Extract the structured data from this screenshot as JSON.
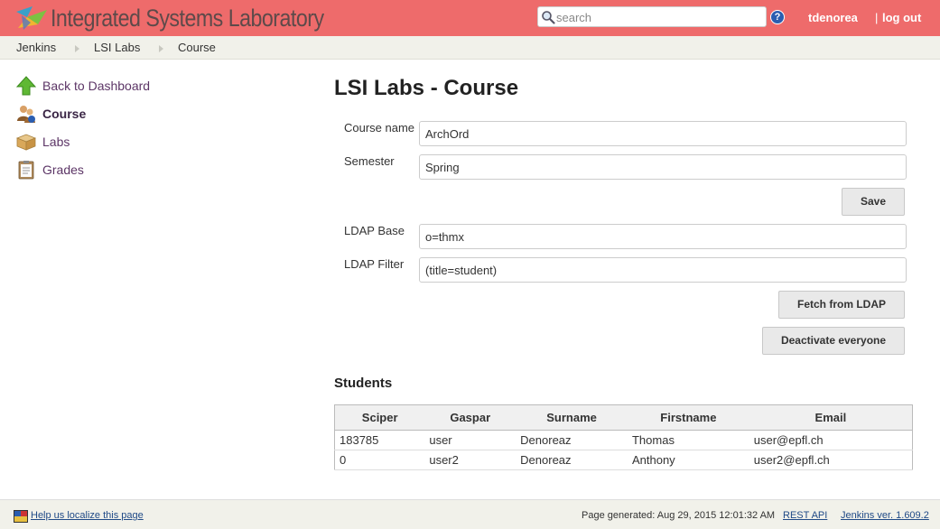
{
  "header": {
    "title": "Integrated Systems Laboratory",
    "search_placeholder": "search",
    "user": "tdenorea",
    "separator": "|",
    "logout": "log out"
  },
  "breadcrumb": [
    "Jenkins",
    "LSI Labs",
    "Course"
  ],
  "sidebar": {
    "items": [
      {
        "label": "Back to Dashboard",
        "icon": "up-arrow-icon"
      },
      {
        "label": "Course",
        "icon": "people-icon"
      },
      {
        "label": "Labs",
        "icon": "box-icon"
      },
      {
        "label": "Grades",
        "icon": "clipboard-icon"
      }
    ]
  },
  "main": {
    "title": "LSI Labs - Course",
    "course_name_label": "Course name",
    "course_name_value": "ArchOrd",
    "semester_label": "Semester",
    "semester_value": "Spring",
    "save_label": "Save",
    "ldap_base_label": "LDAP Base",
    "ldap_base_value": "o=thmx",
    "ldap_filter_label": "LDAP Filter",
    "ldap_filter_value": "(title=student)",
    "fetch_label": "Fetch from LDAP",
    "deactivate_label": "Deactivate everyone",
    "students_title": "Students"
  },
  "students": {
    "headers": [
      "Sciper",
      "Gaspar",
      "Surname",
      "Firstname",
      "Email"
    ],
    "rows": [
      [
        "183785",
        "user",
        "Denoreaz",
        "Thomas",
        "user@epfl.ch"
      ],
      [
        "0",
        "user2",
        "Denoreaz",
        "Anthony",
        "user2@epfl.ch"
      ]
    ]
  },
  "footer": {
    "localize": "Help us localize this page",
    "generated": "Page generated: Aug 29, 2015 12:01:32 AM",
    "rest_api": "REST API",
    "version": "Jenkins ver. 1.609.2"
  }
}
